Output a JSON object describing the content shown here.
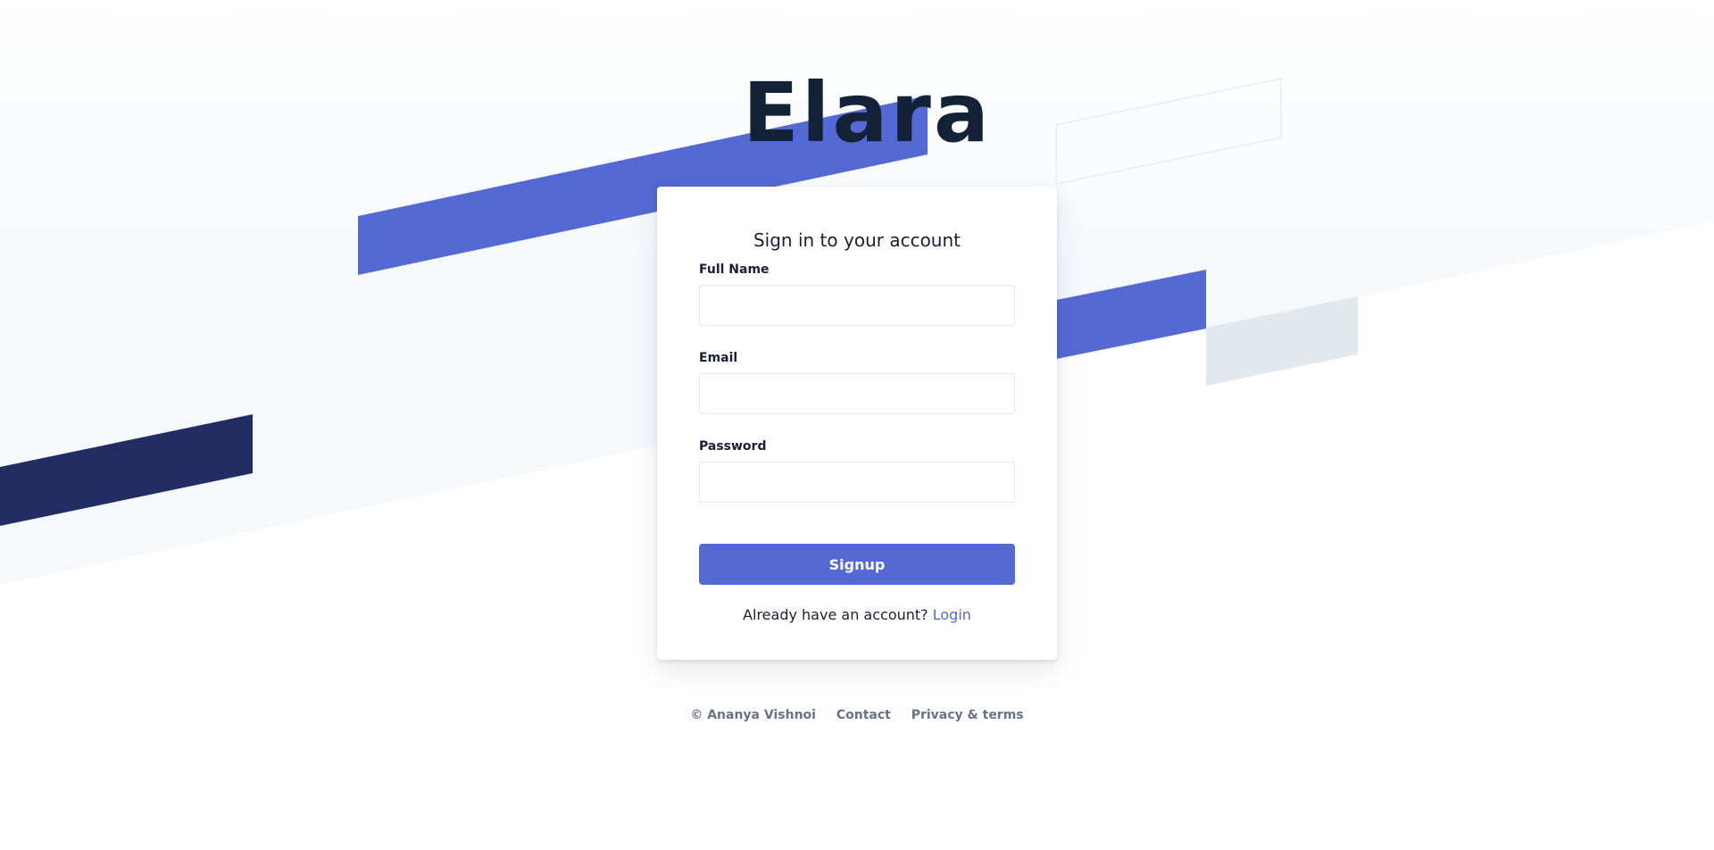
{
  "brand": {
    "name": "Elara"
  },
  "colors": {
    "accent": "#5469d4",
    "navy": "#212d63",
    "text": "#1a1f36",
    "muted": "#697386"
  },
  "form": {
    "title": "Sign in to your account",
    "fields": [
      {
        "label": "Full Name",
        "value": "",
        "placeholder": ""
      },
      {
        "label": "Email",
        "value": "",
        "placeholder": ""
      },
      {
        "label": "Password",
        "value": "",
        "placeholder": ""
      }
    ],
    "submit_label": "Signup",
    "alt_prompt": "Already have an account?",
    "alt_link": "Login"
  },
  "footer": {
    "copyright": "© Ananya Vishnoi",
    "links": [
      "Contact",
      "Privacy & terms"
    ]
  }
}
